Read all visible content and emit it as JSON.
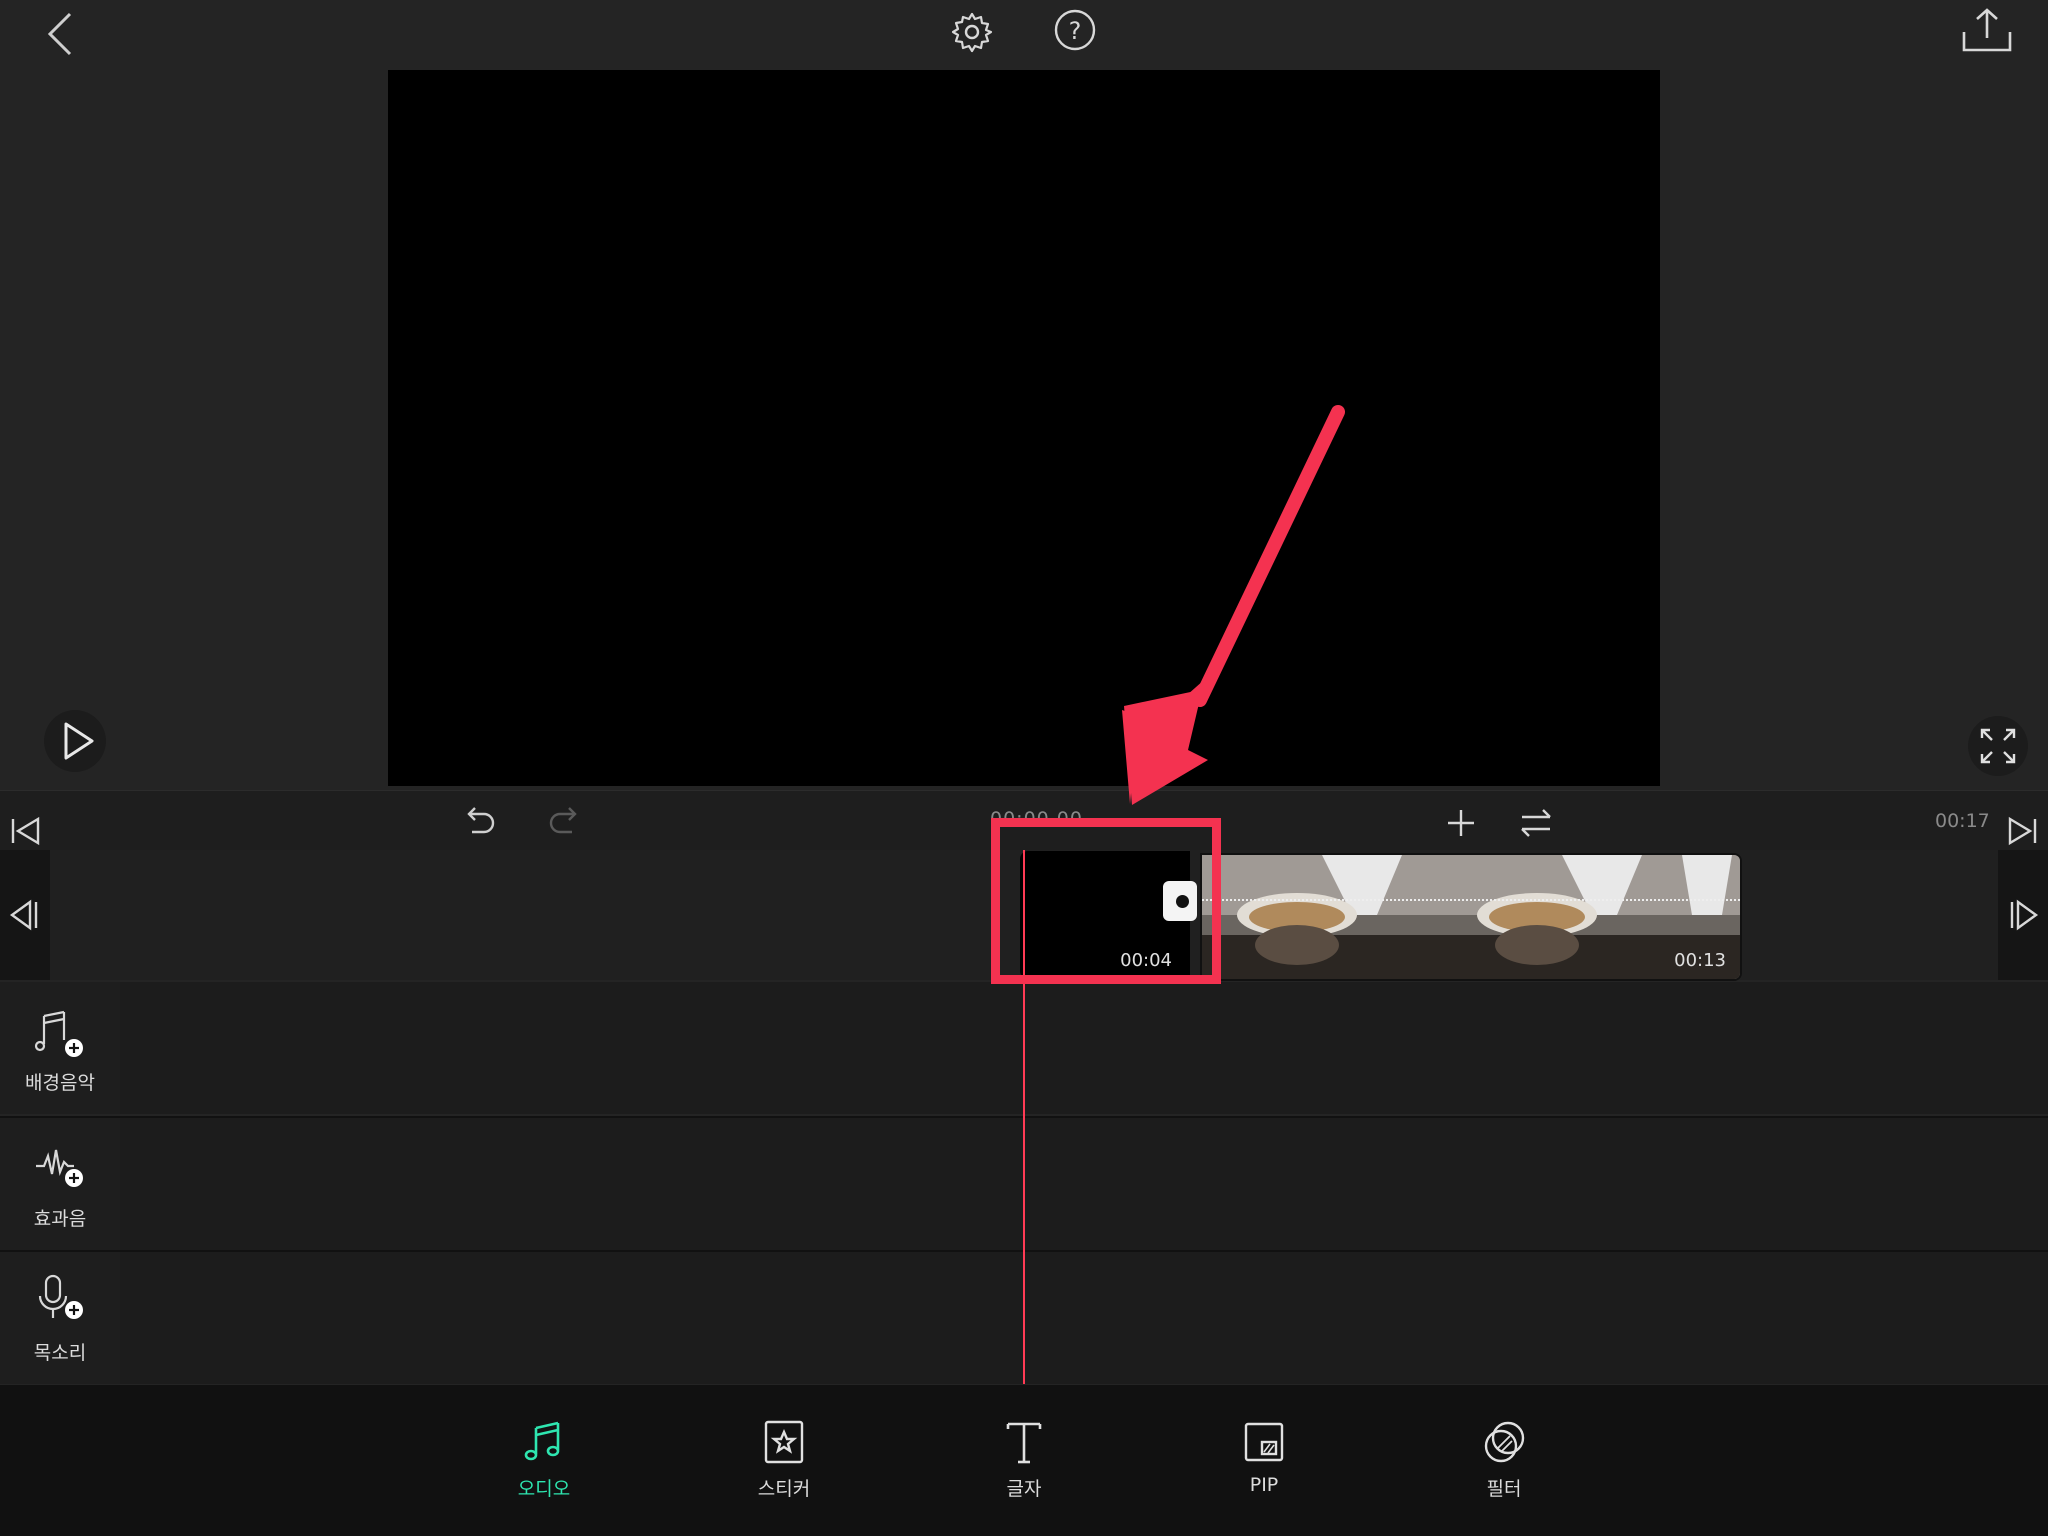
{
  "top_bar": {
    "back_icon": "chevron-left-icon",
    "settings_icon": "gear-icon",
    "help_icon": "question-circle-icon",
    "export_icon": "share-upload-icon"
  },
  "preview": {
    "play_icon": "play-icon",
    "fullscreen_icon": "expand-icon"
  },
  "timeline_controls": {
    "current_time": "00:00.00",
    "total_time": "00:17",
    "undo_icon": "undo-icon",
    "redo_icon": "redo-icon",
    "add_icon": "plus-icon",
    "swap_icon": "swap-arrows-icon"
  },
  "video_track": {
    "clips": [
      {
        "duration": "00:04",
        "type": "black"
      },
      {
        "duration": "00:13",
        "type": "photo"
      }
    ]
  },
  "audio_rows": [
    {
      "label": "배경음악",
      "icon": "music-add-icon"
    },
    {
      "label": "효과음",
      "icon": "waveform-add-icon"
    },
    {
      "label": "목소리",
      "icon": "microphone-add-icon"
    }
  ],
  "bottom_toolbar": {
    "items": [
      {
        "label": "오디오",
        "icon": "music-note-icon",
        "active": true
      },
      {
        "label": "스티커",
        "icon": "star-box-icon",
        "active": false
      },
      {
        "label": "글자",
        "icon": "text-icon",
        "active": false
      },
      {
        "label": "PIP",
        "icon": "pip-icon",
        "active": false
      },
      {
        "label": "필터",
        "icon": "filter-icon",
        "active": false
      }
    ]
  },
  "colors": {
    "accent": "#2ee6b0",
    "playhead": "#ff3b55",
    "annotation": "#f43250",
    "background": "#242424"
  }
}
